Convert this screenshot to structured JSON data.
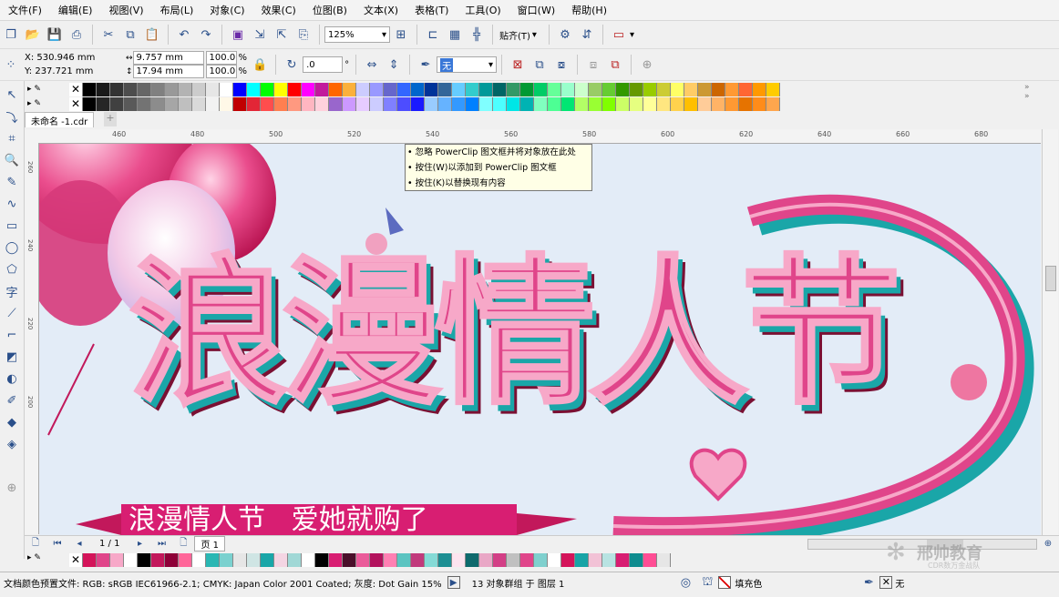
{
  "menu": [
    "文件(F)",
    "编辑(E)",
    "视图(V)",
    "布局(L)",
    "对象(C)",
    "效果(C)",
    "位图(B)",
    "文本(X)",
    "表格(T)",
    "工具(O)",
    "窗口(W)",
    "帮助(H)"
  ],
  "toolbar": {
    "zoom_value": "125%",
    "snap_label": "贴齐(T)"
  },
  "property_bar": {
    "x": "X: 530.946 mm",
    "y": "Y: 237.721 mm",
    "width": "9.757 mm",
    "height": "17.94 mm",
    "scale_x": "100.0",
    "scale_y": "100.0",
    "percent": "%",
    "rotation": ".0",
    "degree": "°",
    "outline_value": "无"
  },
  "document": {
    "tab_name": "未命名 -1.cdr"
  },
  "ruler": {
    "h_ticks": [
      "460",
      "480",
      "500",
      "520",
      "540",
      "560",
      "580",
      "600",
      "620",
      "640",
      "660",
      "680"
    ],
    "v_ticks": [
      "260",
      "240",
      "220",
      "200"
    ]
  },
  "tooltip": {
    "lines": [
      "• 忽略 PowerClip 图文框并将对象放在此处",
      "• 按住(W)以添加到 PowerClip 图文框",
      "• 按住(K)以替换现有内容"
    ]
  },
  "artwork": {
    "main_title": "浪漫情人节",
    "banner_text": "浪漫情人节   爱她就购了"
  },
  "page_nav": {
    "counter": "1 / 1",
    "page_tab": "页 1"
  },
  "watermark": {
    "name": "邢帅教育",
    "sub": "CDR数万金战队"
  },
  "status": {
    "color_profile": "文档颜色预置文件: RGB: sRGB IEC61966-2.1; CMYK: Japan Color 2001 Coated; 灰度: Dot Gain 15%",
    "selection": "13 对象群组 于 图层 1",
    "fill_label": "填充色",
    "outline_label": "无"
  },
  "colors": {
    "accent_pink": "#e0458a",
    "teal": "#1aa6a8",
    "banner_magenta": "#d81e72",
    "canvas_bg": "#e3ecf7"
  },
  "palette_top_1": [
    "#000000",
    "#1a1a1a",
    "#333333",
    "#4d4d4d",
    "#666666",
    "#808080",
    "#999999",
    "#b3b3b3",
    "#cccccc",
    "#e6e6e6",
    "#ffffff",
    "#0000ff",
    "#00ffff",
    "#00ff00",
    "#ffff00",
    "#ff0000",
    "#ff00ff",
    "#c21a9c",
    "#ff6600",
    "#fbb03b",
    "#ccccff",
    "#9999ff",
    "#6666cc",
    "#3366ff",
    "#0066cc",
    "#003399",
    "#336699",
    "#66ccff",
    "#33cccc",
    "#009999",
    "#006666",
    "#339966",
    "#009933",
    "#00cc66",
    "#66ff99",
    "#99ffcc",
    "#ccffcc",
    "#99cc66",
    "#66cc33",
    "#339900",
    "#669900",
    "#99cc00",
    "#cccc33",
    "#ffff66",
    "#ffcc66",
    "#cc9933",
    "#cc6600",
    "#ff9933",
    "#ff6633",
    "#ff9900",
    "#ffcc00"
  ],
  "palette_top_2": [
    "#000000",
    "#262626",
    "#404040",
    "#595959",
    "#737373",
    "#8c8c8c",
    "#a6a6a6",
    "#bfbfbf",
    "#d9d9d9",
    "#f2f2f2",
    "#fff8e7",
    "#c00000",
    "#e32636",
    "#ff4d4d",
    "#ff7f50",
    "#ff9980",
    "#ffb6c1",
    "#ffd1dc",
    "#9966cc",
    "#cc99ff",
    "#e6ccff",
    "#ccccff",
    "#8080ff",
    "#4d4dff",
    "#1a1aff",
    "#99ccff",
    "#66b3ff",
    "#3399ff",
    "#0080ff",
    "#80ffff",
    "#4dffff",
    "#00e6e6",
    "#00b3b3",
    "#80ffbf",
    "#4dff94",
    "#00e673",
    "#b3ff66",
    "#99ff33",
    "#80ff00",
    "#ccff66",
    "#e6ff80",
    "#ffff99",
    "#ffe680",
    "#ffd24d",
    "#ffbf00",
    "#ffcc99",
    "#ffb366",
    "#ff9933",
    "#e67300",
    "#ff8c1a",
    "#ffa64d"
  ],
  "palette_bottom": [
    "#d4145a",
    "#e0458a",
    "#f7a8c8",
    "#ffffff",
    "#000000",
    "#c2185b",
    "#8e0038",
    "#ff6699",
    "#ffffff",
    "#2ab7b3",
    "#7ad1cf",
    "#e6e6e6",
    "#cfe5e4",
    "#1aa6a8",
    "#f4d5e3",
    "#a0d8d6",
    "#ffffff",
    "#000000",
    "#d81e72",
    "#4a0f2a",
    "#ea5b9a",
    "#b3125d",
    "#ff80b3",
    "#5bc4c1",
    "#c13a7c",
    "#84dad6",
    "#1c8f93",
    "#fce4ef",
    "#0f6a6d",
    "#e9a7c6",
    "#d33f86",
    "#c0c0c0",
    "#e0458a",
    "#7fd0ce",
    "#ffffff",
    "#d4145a",
    "#18a4a6",
    "#f2c2d6",
    "#b8e3e2",
    "#d81e72",
    "#0e8c8f",
    "#ff4d94",
    "#e6e6e6"
  ]
}
